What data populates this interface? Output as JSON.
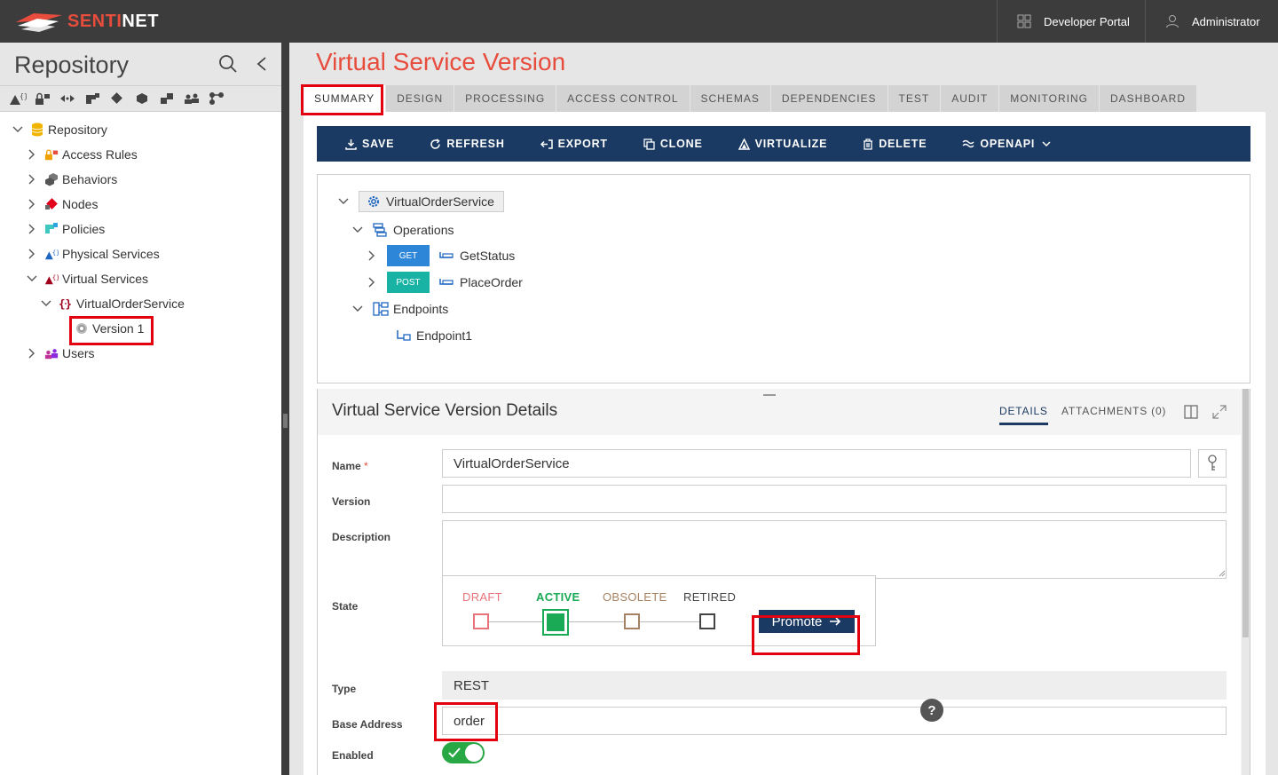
{
  "app": {
    "logo_prefix": "S",
    "logo_red": "ENTI",
    "logo_white": "NET",
    "developer_portal": "Developer Portal",
    "administrator": "Administrator"
  },
  "sidebar": {
    "title": "Repository",
    "tree": {
      "root": "Repository",
      "items": [
        {
          "label": "Access Rules"
        },
        {
          "label": "Behaviors"
        },
        {
          "label": "Nodes"
        },
        {
          "label": "Policies"
        },
        {
          "label": "Physical Services"
        },
        {
          "label": "Virtual Services"
        },
        {
          "label": "VirtualOrderService"
        },
        {
          "label": "Version 1"
        },
        {
          "label": "Users"
        }
      ]
    }
  },
  "main": {
    "title": "Virtual Service Version",
    "tabs": [
      "SUMMARY",
      "DESIGN",
      "PROCESSING",
      "ACCESS CONTROL",
      "SCHEMAS",
      "DEPENDENCIES",
      "TEST",
      "AUDIT",
      "MONITORING",
      "DASHBOARD"
    ],
    "actions": [
      "SAVE",
      "REFRESH",
      "EXPORT",
      "CLONE",
      "VIRTUALIZE",
      "DELETE",
      "OPENAPI"
    ],
    "service_tree": {
      "service": "VirtualOrderService",
      "operations": "Operations",
      "ops": [
        {
          "method": "GET",
          "name": "GetStatus"
        },
        {
          "method": "POST",
          "name": "PlaceOrder"
        }
      ],
      "endpoints": "Endpoints",
      "endpoint1": "Endpoint1"
    },
    "details": {
      "title": "Virtual Service Version Details",
      "tab_details": "DETAILS",
      "tab_attachments": "ATTACHMENTS (0)",
      "labels": {
        "name": "Name",
        "required": "*",
        "version": "Version",
        "description": "Description",
        "state": "State",
        "type": "Type",
        "base_address": "Base Address",
        "enabled": "Enabled"
      },
      "values": {
        "name": "VirtualOrderService",
        "version": "",
        "description": "",
        "type": "REST",
        "base_address": "order",
        "enabled": true
      },
      "states": [
        "DRAFT",
        "ACTIVE",
        "OBSOLETE",
        "RETIRED"
      ],
      "current_state": "ACTIVE",
      "promote": "Promote"
    },
    "help": "?"
  },
  "colors": {
    "brand_red": "#e74c3c",
    "navy": "#1a3a63",
    "active_green": "#1aa955",
    "draft_red": "#e8737b",
    "obsolete_brown": "#a68262",
    "retired_dark": "#444444",
    "highlight": "#e3000f"
  }
}
